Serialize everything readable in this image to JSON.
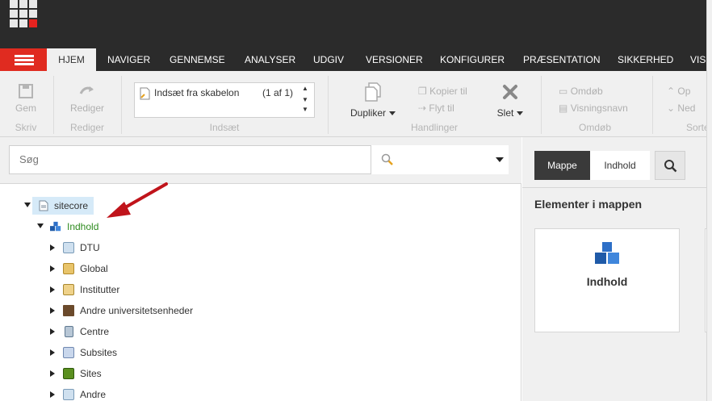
{
  "tabs": [
    "HJEM",
    "NAVIGER",
    "GENNEMSE",
    "ANALYSER",
    "UDGIV",
    "VERSIONER",
    "KONFIGURER",
    "PRÆSENTATION",
    "SIKKERHED",
    "VIS"
  ],
  "ribbon": {
    "save_label": "Gem",
    "write_title": "Skriv",
    "edit_label": "Rediger",
    "edit_title": "Rediger",
    "insert_item": "Indsæt fra skabelon",
    "insert_count": "(1 af 1)",
    "insert_title": "Indsæt",
    "duplicate_label": "Dupliker",
    "copy_to_label": "Kopier til",
    "move_to_label": "Flyt til",
    "delete_label": "Slet",
    "actions_title": "Handlinger",
    "rename_label": "Omdøb",
    "display_name_label": "Visningsnavn",
    "rename_title": "Omdøb",
    "up_label": "Op",
    "down_label": "Ned",
    "sort_title": "Sorte"
  },
  "search": {
    "placeholder": "Søg"
  },
  "tree": {
    "root": "sitecore",
    "content": "Indhold",
    "children": [
      "DTU",
      "Global",
      "Institutter",
      "Andre universitetsenheder",
      "Centre",
      "Subsites",
      "Sites",
      "Andre"
    ]
  },
  "right": {
    "tab_folder": "Mappe",
    "tab_content": "Indhold",
    "heading": "Elementer i mappen",
    "card_label": "Indhold"
  },
  "colors": {
    "topbar": "#2b2b2b",
    "accent_red": "#e02b20",
    "content_green": "#2e8b1f",
    "annotation_arrow": "#c0141b"
  }
}
